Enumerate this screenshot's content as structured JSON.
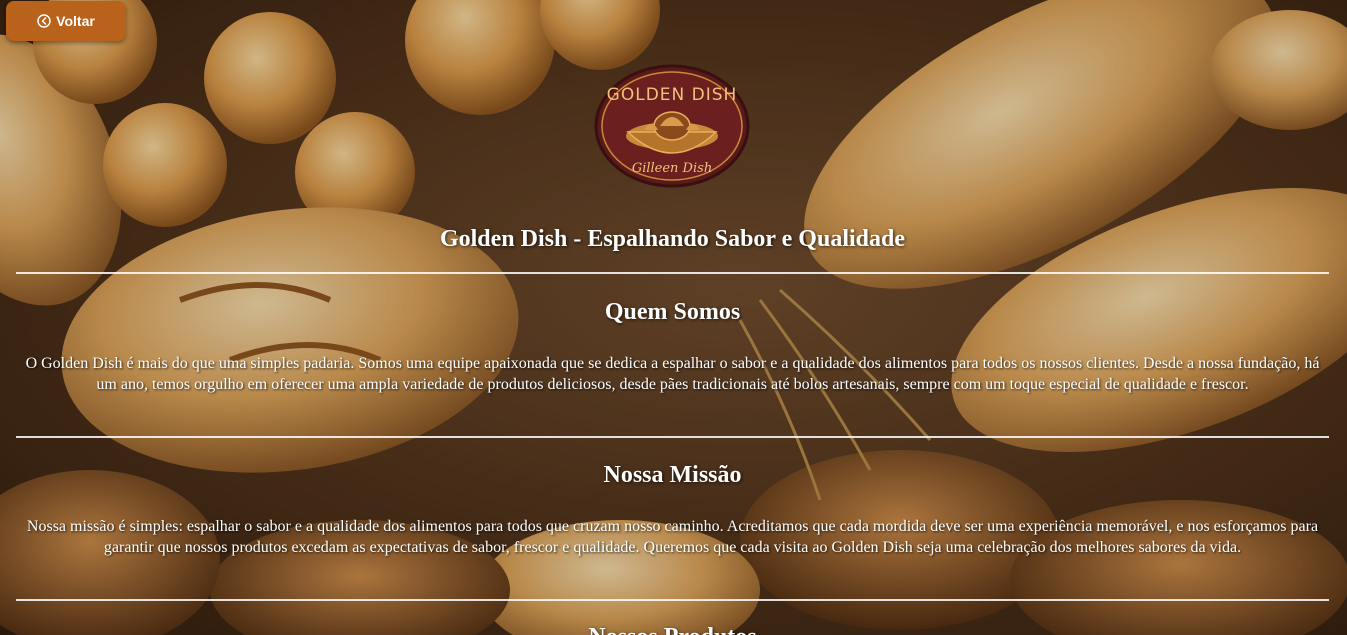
{
  "nav": {
    "back_label": "Voltar",
    "back_icon": "arrow-left-circle-icon"
  },
  "brand": {
    "logo_top_text": "GOLDEN DISH",
    "logo_bottom_text": "Gilleen Dish",
    "colors": {
      "button": "#b8621c",
      "logo_ring": "#6b1f1f",
      "logo_gold": "#e8b05a"
    }
  },
  "page": {
    "title": "Golden Dish - Espalhando Sabor e Qualidade"
  },
  "sections": [
    {
      "title": "Quem Somos",
      "text": "O Golden Dish é mais do que uma simples padaria. Somos uma equipe apaixonada que se dedica a espalhar o sabor e a qualidade dos alimentos para todos os nossos clientes. Desde a nossa fundação, há um ano, temos orgulho em oferecer uma ampla variedade de produtos deliciosos, desde pães tradicionais até bolos artesanais, sempre com um toque especial de qualidade e frescor."
    },
    {
      "title": "Nossa Missão",
      "text": "Nossa missão é simples: espalhar o sabor e a qualidade dos alimentos para todos que cruzam nosso caminho. Acreditamos que cada mordida deve ser uma experiência memorável, e nos esforçamos para garantir que nossos produtos excedam as expectativas de sabor, frescor e qualidade. Queremos que cada visita ao Golden Dish seja uma celebração dos melhores sabores da vida."
    },
    {
      "title": "Nossos Produtos"
    }
  ]
}
